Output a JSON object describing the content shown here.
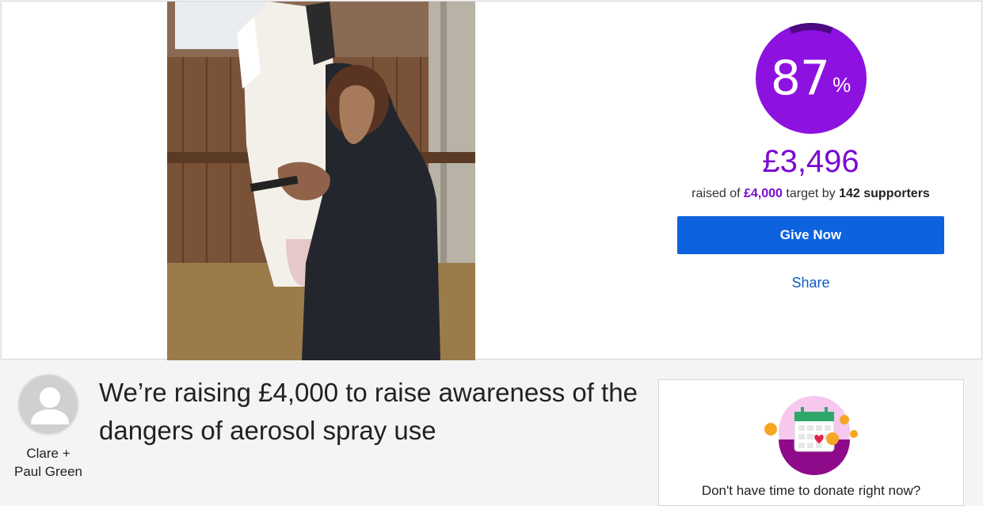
{
  "campaign": {
    "photo_alt": "Girl hugging a horse in a stable"
  },
  "progress": {
    "percent_value": "87",
    "percent_sign": "%",
    "percent_fraction": 0.87,
    "raised": "£3,496",
    "raised_of_prefix": "raised of",
    "target": "£4,000",
    "target_by": "target by",
    "supporters": "142 supporters",
    "accent_color": "#7a0ad1",
    "ring_dark_color": "#4b0a80"
  },
  "actions": {
    "give_now": "Give Now",
    "share": "Share",
    "button_color": "#0d63de"
  },
  "owner": {
    "name_line1": "Clare +",
    "name_line2": "Paul Green"
  },
  "story": {
    "headline": "We’re raising £4,000 to raise awareness of the dangers of aerosol spray use"
  },
  "promo": {
    "icon": "calendar-heart-icon",
    "text": "Don't have time to donate right now?"
  }
}
